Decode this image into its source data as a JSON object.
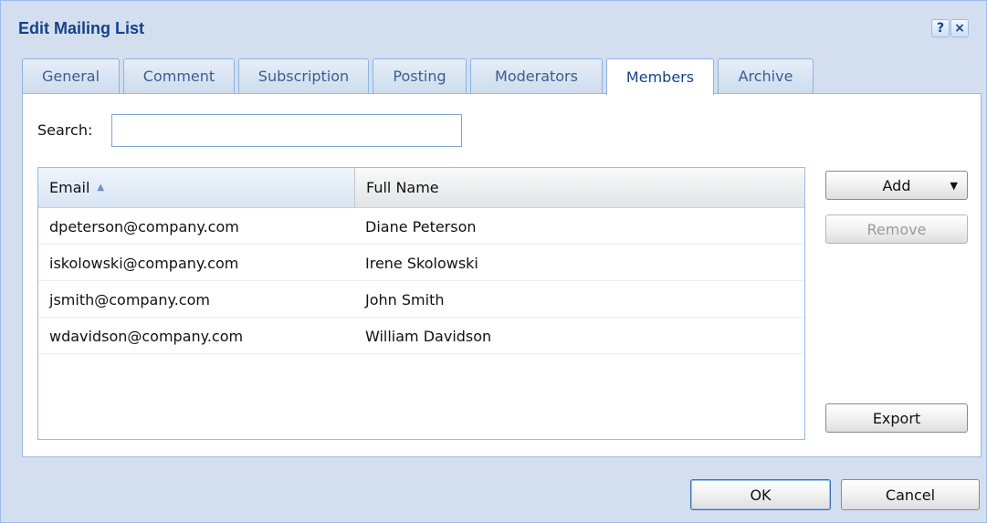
{
  "dialog": {
    "title": "Edit Mailing List",
    "help_icon": "?",
    "close_icon": "×"
  },
  "tabs": [
    {
      "label": "General",
      "active": false
    },
    {
      "label": "Comment",
      "active": false
    },
    {
      "label": "Subscription",
      "active": false
    },
    {
      "label": "Posting",
      "active": false
    },
    {
      "label": "Moderators",
      "active": false
    },
    {
      "label": "Members",
      "active": true
    },
    {
      "label": "Archive",
      "active": false
    }
  ],
  "search": {
    "label": "Search:",
    "value": ""
  },
  "grid": {
    "columns": {
      "email": "Email",
      "full_name": "Full Name",
      "sort_indicator": "▲"
    },
    "rows": [
      {
        "email": "dpeterson@company.com",
        "full_name": "Diane Peterson"
      },
      {
        "email": "iskolowski@company.com",
        "full_name": "Irene Skolowski"
      },
      {
        "email": "jsmith@company.com",
        "full_name": "John Smith"
      },
      {
        "email": "wdavidson@company.com",
        "full_name": "William Davidson"
      }
    ]
  },
  "actions": {
    "add": "Add",
    "add_caret": "▼",
    "remove": "Remove",
    "export": "Export"
  },
  "footer": {
    "ok": "OK",
    "cancel": "Cancel"
  },
  "colors": {
    "accent": "#15428b",
    "frame": "#d3dfee",
    "border": "#99bbe8"
  }
}
